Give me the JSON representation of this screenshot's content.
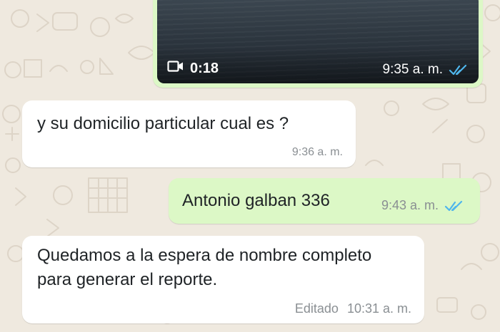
{
  "chat": {
    "messages": [
      {
        "type": "video",
        "direction": "outgoing",
        "duration": "0:18",
        "time": "9:35 a. m.",
        "status_icon": "double-check-read-icon"
      },
      {
        "type": "text",
        "direction": "incoming",
        "text": "y su domicilio particular cual es ?",
        "time": "9:36 a. m."
      },
      {
        "type": "text",
        "direction": "outgoing",
        "text": "Antonio galban 336",
        "time": "9:43 a. m.",
        "status_icon": "double-check-read-icon"
      },
      {
        "type": "text",
        "direction": "incoming",
        "text": "Quedamos a la espera de nombre completo para generar el reporte.",
        "edited_label": "Editado",
        "time": "10:31 a. m."
      }
    ]
  },
  "theme": {
    "background": "#efe9df",
    "outgoing_bubble": "#dcf8c6",
    "incoming_bubble": "#ffffff",
    "read_tick": "#4fb6ec",
    "video_icon": "video-camera-icon"
  }
}
